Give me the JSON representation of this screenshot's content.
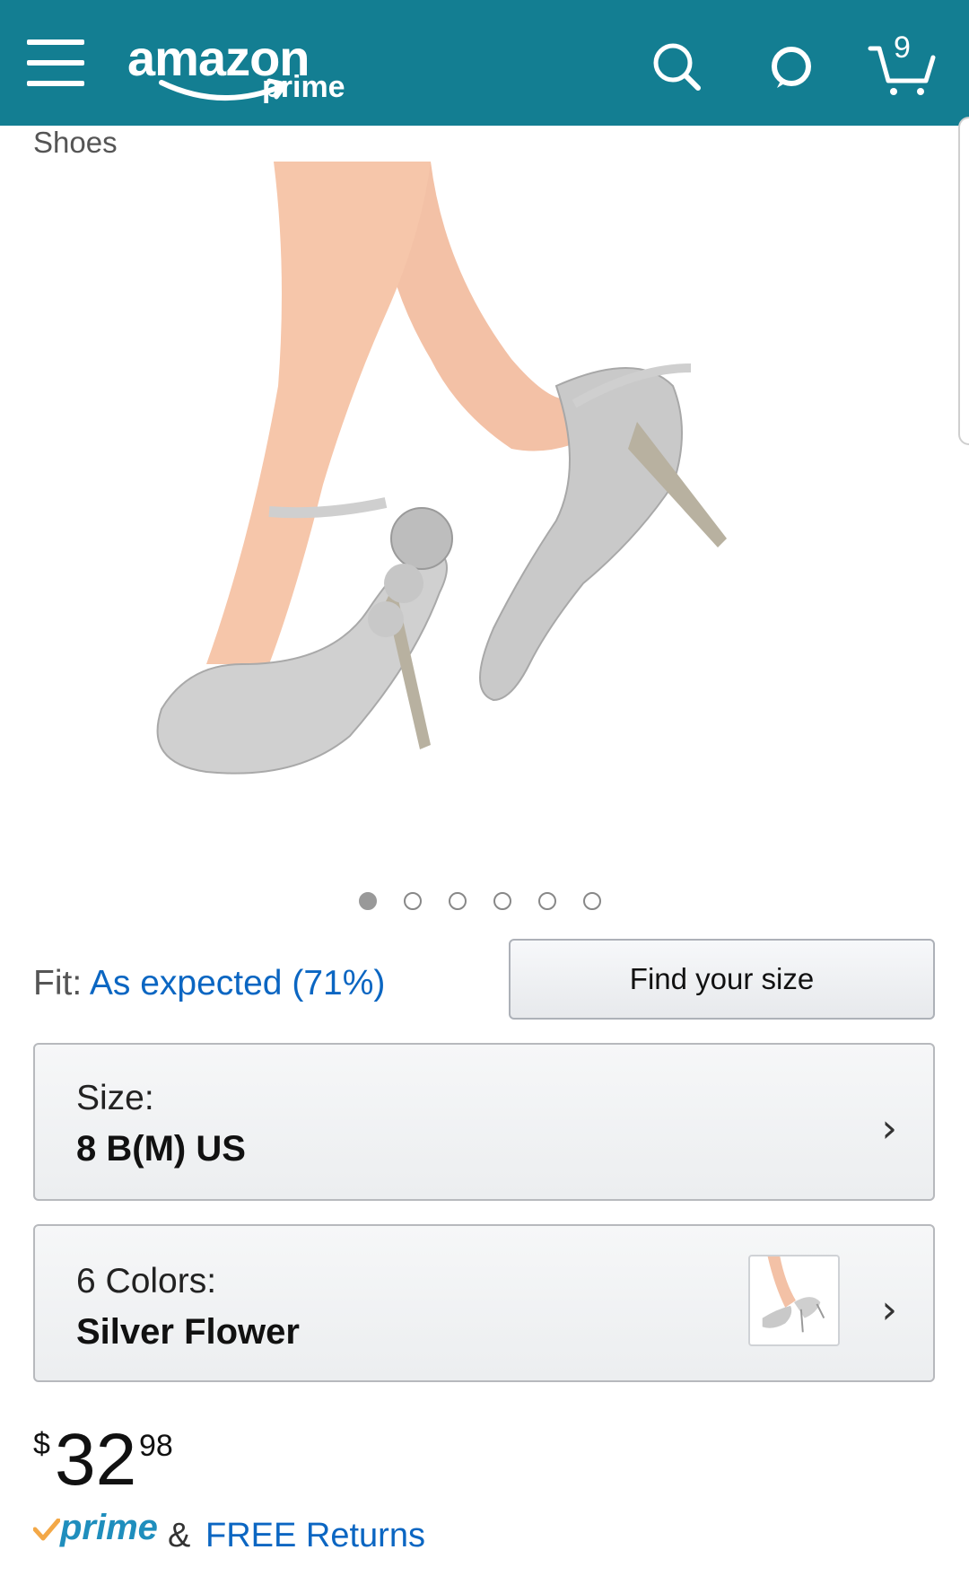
{
  "header": {
    "logo_text": "amazon",
    "logo_subtext": "prime",
    "cart_count": "9",
    "bg_color": "#137e92"
  },
  "category": "Shoes",
  "gallery": {
    "total_images": 6,
    "active_index": 0
  },
  "fit": {
    "label": "Fit:",
    "value": "As expected (71%)"
  },
  "find_size_label": "Find your size",
  "size": {
    "label": "Size:",
    "value": "8 B(M) US"
  },
  "color": {
    "label": "6 Colors:",
    "value": "Silver Flower"
  },
  "price": {
    "symbol": "$",
    "whole": "32",
    "fraction": "98"
  },
  "shipping": {
    "prime": "prime",
    "amp": "&",
    "returns": "FREE Returns"
  },
  "icons": [
    "menu-icon",
    "search-icon",
    "voice-assistant-icon",
    "cart-icon",
    "chevron-right-icon",
    "prime-check-icon"
  ],
  "colors": {
    "link": "#0b66c2",
    "prime_blue": "#1f8ebd",
    "prime_check": "#f3a847"
  }
}
